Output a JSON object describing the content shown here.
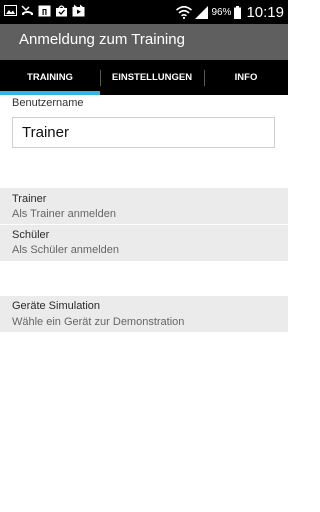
{
  "status_bar": {
    "battery": "96%",
    "time": "10:19",
    "icons": [
      "gallery-icon",
      "missed-call-icon",
      "calendar-icon",
      "bag-icon",
      "video-icon",
      "wifi-icon",
      "signal-icon",
      "battery-icon"
    ]
  },
  "app": {
    "title": "Anmeldung zum Training"
  },
  "tabs": [
    {
      "label": "TRAINING",
      "selected": true
    },
    {
      "label": "EINSTELLUNGEN",
      "selected": false
    },
    {
      "label": "INFO",
      "selected": false
    }
  ],
  "login": {
    "username_label": "Benutzername",
    "username_value": "Trainer"
  },
  "roles": [
    {
      "title": "Trainer",
      "subtitle": "Als Trainer anmelden"
    },
    {
      "title": "Schüler",
      "subtitle": "Als Schüler anmelden"
    }
  ],
  "simulation": {
    "title": "Geräte Simulation",
    "subtitle": "Wähle ein Gerät zur Demonstration"
  },
  "colors": {
    "status_bar": "#000000",
    "action_bar": "#5f5f5f",
    "tab_indicator": "#33b5e5",
    "list_background": "#ebebeb"
  }
}
